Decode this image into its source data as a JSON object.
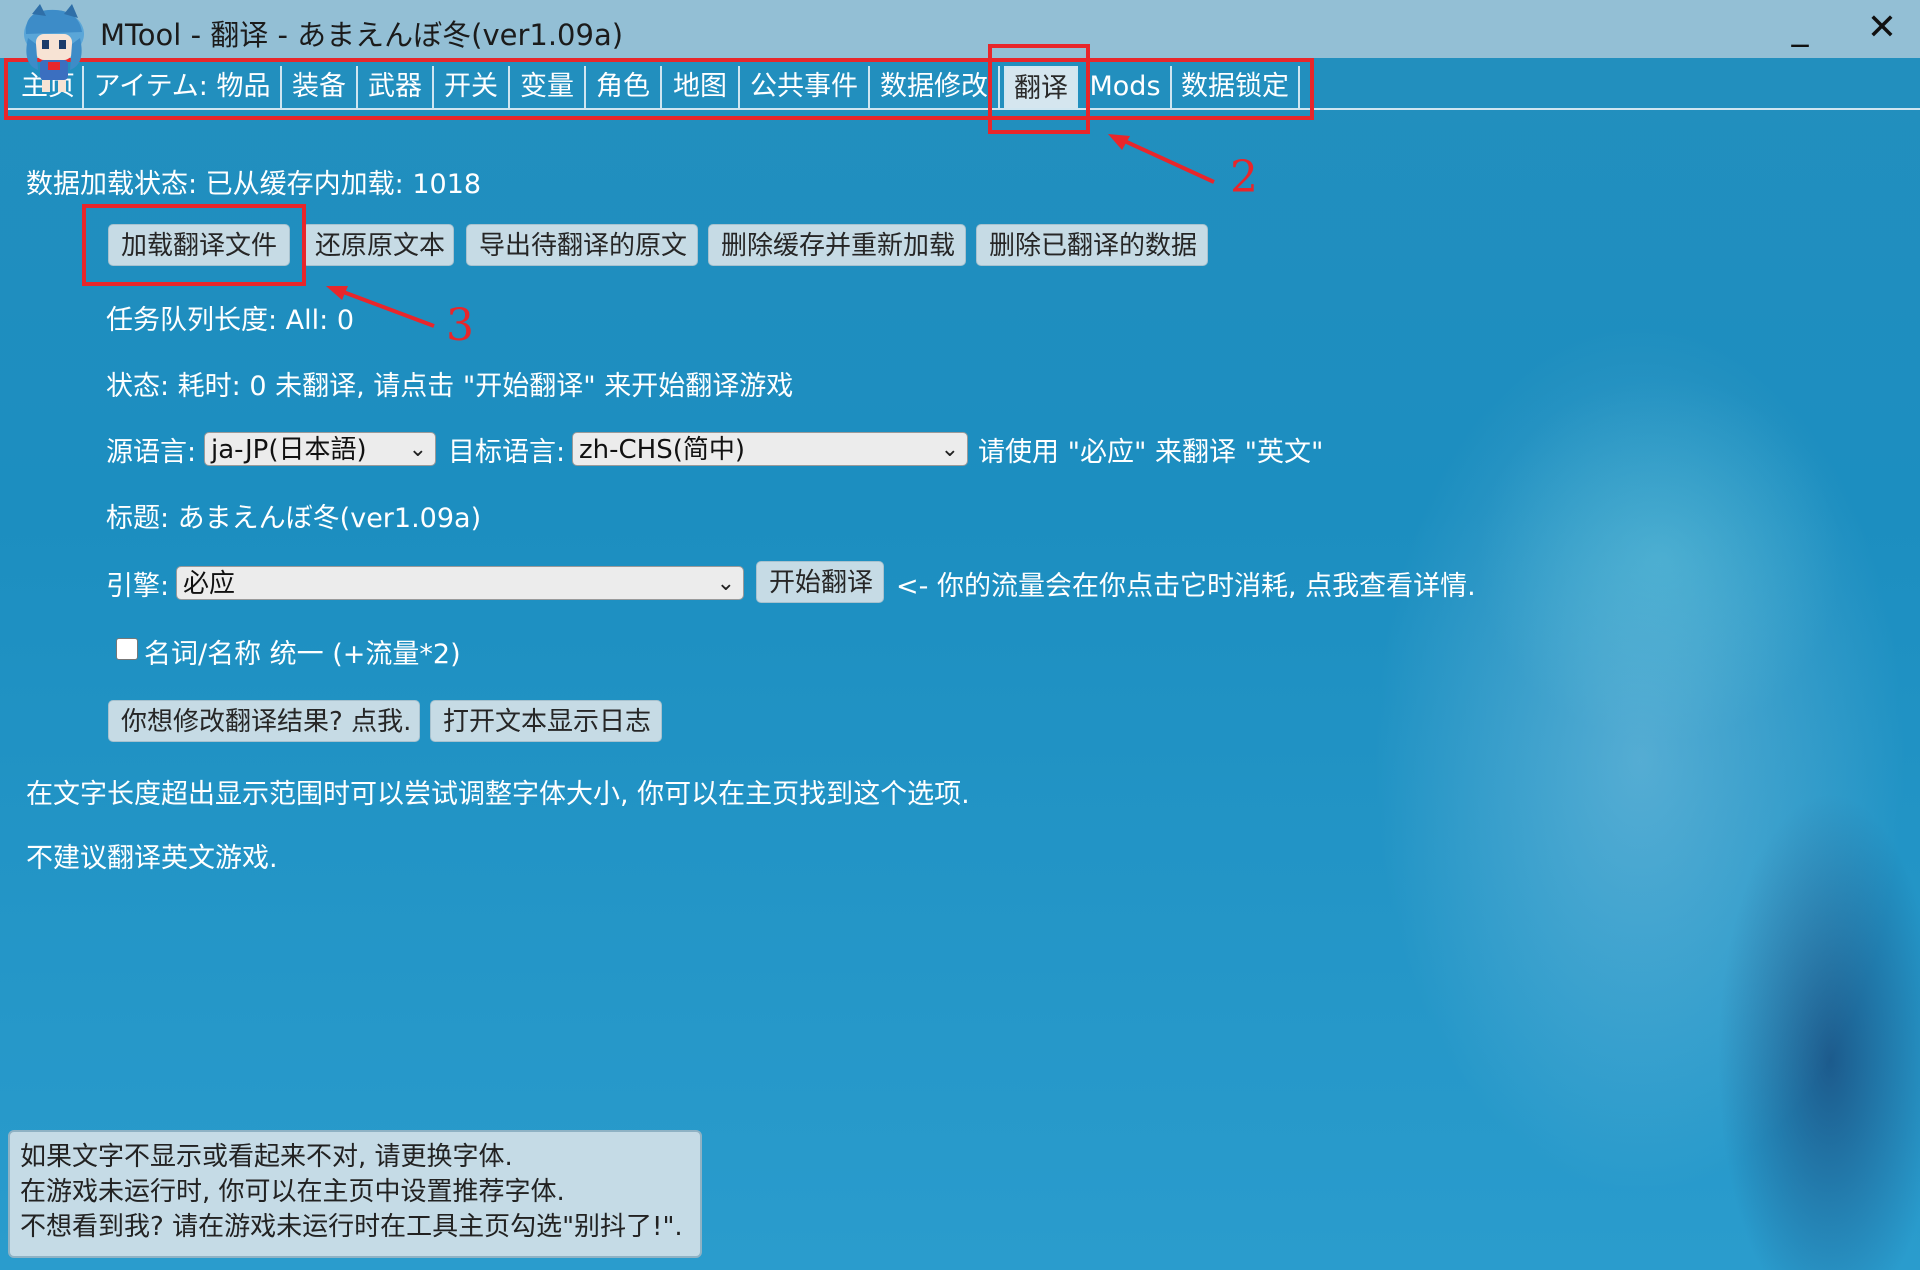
{
  "window": {
    "title": "MTool - 翻译 - あまえんぼ冬(ver1.09a)",
    "minimize_symbol": "_",
    "close_symbol": "✕"
  },
  "tabs": [
    {
      "label": "主页"
    },
    {
      "label": "アイテム: 物品"
    },
    {
      "label": "装备"
    },
    {
      "label": "武器"
    },
    {
      "label": "开关"
    },
    {
      "label": "变量"
    },
    {
      "label": "角色"
    },
    {
      "label": "地图"
    },
    {
      "label": "公共事件"
    },
    {
      "label": "数据修改"
    },
    {
      "label": "翻译",
      "active": true
    },
    {
      "label": "Mods"
    },
    {
      "label": "数据锁定"
    }
  ],
  "translate_page": {
    "load_status": "数据加载状态: 已从缓存内加载: 1018",
    "buttons": {
      "load_file": "加载翻译文件",
      "restore": "还原原文本",
      "export": "导出待翻译的原文",
      "clear_reload": "删除缓存并重新加载",
      "delete_translated": "删除已翻译的数据"
    },
    "queue": "任务队列长度: All: 0",
    "status": "状态: 耗时: 0 未翻译, 请点击 \"开始翻译\" 来开始翻译游戏",
    "source_label": "源语言:",
    "source_value": "ja-JP(日本語)",
    "target_label": "目标语言:",
    "target_value": "zh-CHS(简中)",
    "engine_hint": "请使用 \"必应\" 来翻译 \"英文\"",
    "game_title": "标题: あまえんぼ冬(ver1.09a)",
    "engine_label": "引擎:",
    "engine_value": "必应",
    "start_button": "开始翻译",
    "traffic_note": "<- 你的流量会在你点击它时消耗, 点我查看详情.",
    "unify_names": "名词/名称 统一 (+流量*2)",
    "edit_results_button": "你想修改翻译结果? 点我.",
    "open_log_button": "打开文本显示日志",
    "font_tip": "在文字长度超出显示范围时可以尝试调整字体大小, 你可以在主页找到这个选项.",
    "english_tip": "不建议翻译英文游戏."
  },
  "tooltip": {
    "line1": "如果文字不显示或看起来不对, 请更换字体.",
    "line2": "在游戏未运行时, 你可以在主页中设置推荐字体.",
    "line3": "不想看到我? 请在游戏未运行时在工具主页勾选\"别抖了!\"."
  },
  "annotations": {
    "label_2": "2",
    "label_3": "3",
    "color": "#e8262b"
  },
  "icons": {
    "app": "chibi-character-icon",
    "dropdown": "chevron-down-icon"
  }
}
